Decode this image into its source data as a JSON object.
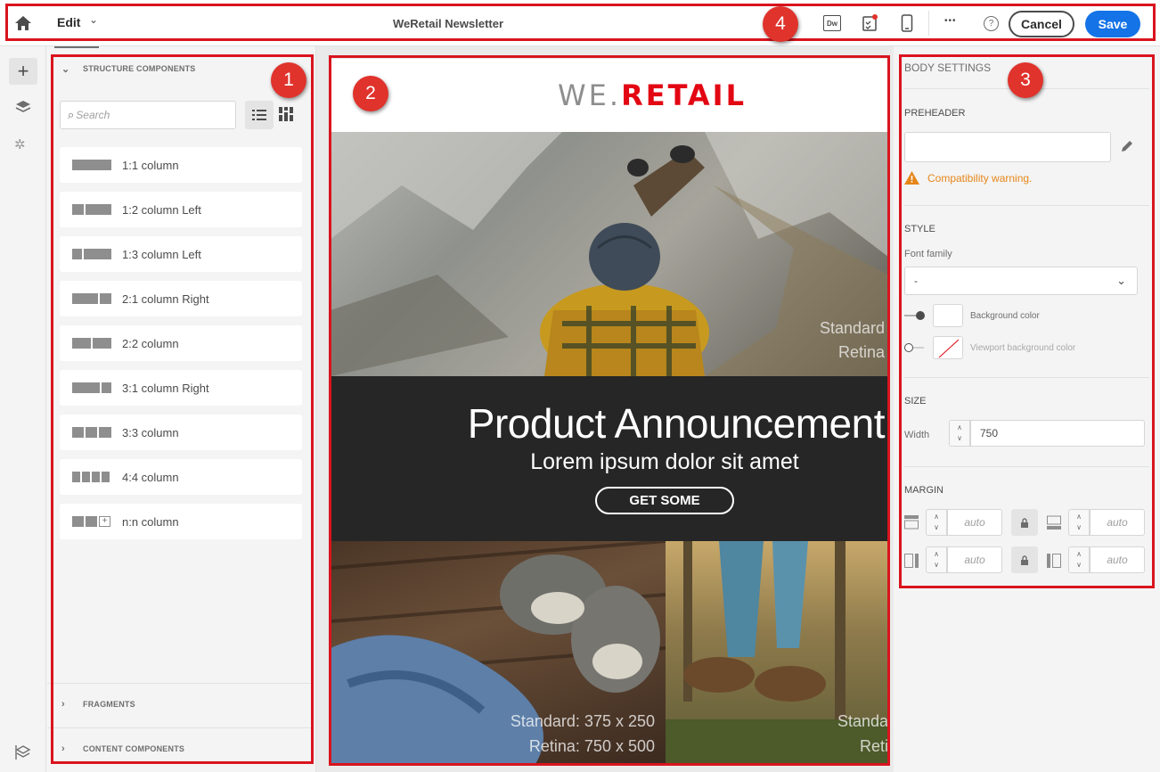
{
  "topbar": {
    "mode_label": "Edit",
    "title": "WeRetail Newsletter",
    "dw_label": "Dw",
    "cancel_label": "Cancel",
    "save_label": "Save",
    "more_label": "•••",
    "help_label": "?"
  },
  "callouts": [
    "1",
    "2",
    "3",
    "4"
  ],
  "left_panel": {
    "structure_header": "STRUCTURE COMPONENTS",
    "search_placeholder": "Search",
    "components": [
      {
        "label": "1:1 column"
      },
      {
        "label": "1:2 column Left"
      },
      {
        "label": "1:3 column Left"
      },
      {
        "label": "2:1 column Right"
      },
      {
        "label": "2:2 column"
      },
      {
        "label": "3:1 column Right"
      },
      {
        "label": "3:3 column"
      },
      {
        "label": "4:4 column"
      },
      {
        "label": "n:n column"
      }
    ],
    "fragments_header": "FRAGMENTS",
    "content_header": "CONTENT COMPONENTS"
  },
  "canvas": {
    "logo_we": "WE.",
    "logo_retail": "RETAIL",
    "hero_watermark_1": "Standard",
    "hero_watermark_2": "Retina",
    "headline": "Product Announcement",
    "subheadline": "Lorem ipsum dolor sit amet",
    "cta_label": "GET SOME",
    "img_left_line1": "Standard: 375 x 250",
    "img_left_line2": "Retina: 750 x 500",
    "img_right_line1": "Standa",
    "img_right_line2": "Reti"
  },
  "right_panel": {
    "title": "BODY SETTINGS",
    "preheader_label": "PREHEADER",
    "preheader_value": "",
    "warning_text": "Compatibility warning.",
    "style_label": "STYLE",
    "font_family_label": "Font family",
    "font_family_value": "-",
    "bg_color_label": "Background color",
    "viewport_bg_label": "Viewport background color",
    "size_label": "SIZE",
    "width_label": "Width",
    "width_value": "750",
    "margin_label": "MARGIN",
    "margin_top": "auto",
    "margin_bottom": "auto",
    "margin_left": "auto",
    "margin_right": "auto"
  },
  "colors": {
    "accent_blue": "#1473e6",
    "brand_red": "#e30613",
    "annotation_red": "#d9141e",
    "warning_orange": "#e68619"
  }
}
